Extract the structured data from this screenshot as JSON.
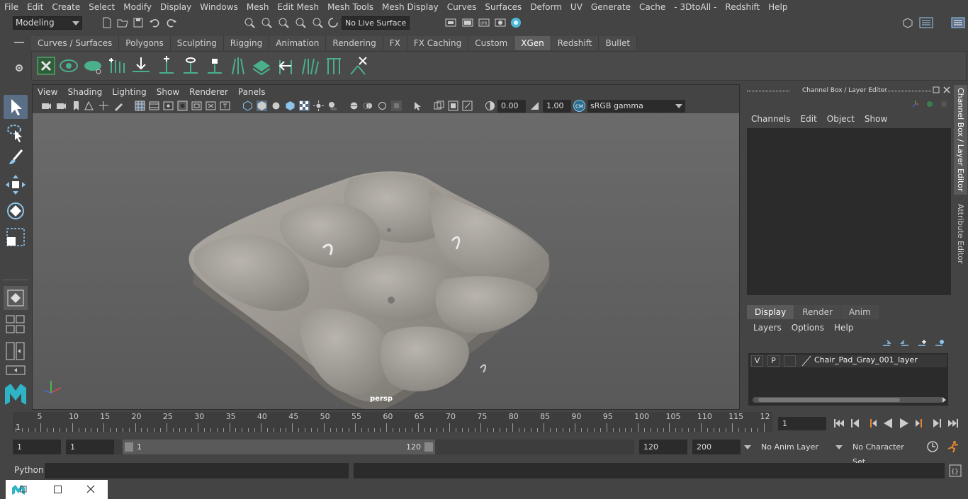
{
  "menubar": {
    "items": [
      "File",
      "Edit",
      "Create",
      "Select",
      "Modify",
      "Display",
      "Windows",
      "Mesh",
      "Edit Mesh",
      "Mesh Tools",
      "Mesh Display",
      "Curves",
      "Surfaces",
      "Deform",
      "UV",
      "Generate",
      "Cache",
      "- 3DtoAll -",
      "Redshift",
      "Help"
    ]
  },
  "statusline": {
    "mode": "Modeling",
    "live_surface": "No Live Surface"
  },
  "shelf": {
    "tabs": [
      "Curves / Surfaces",
      "Polygons",
      "Sculpting",
      "Rigging",
      "Animation",
      "Rendering",
      "FX",
      "FX Caching",
      "Custom",
      "XGen",
      "Redshift",
      "Bullet"
    ],
    "active_tab": "XGen"
  },
  "viewport": {
    "menu": [
      "View",
      "Shading",
      "Lighting",
      "Show",
      "Renderer",
      "Panels"
    ],
    "exposure": "0.00",
    "gamma_value": "1.00",
    "color_space": "sRGB gamma",
    "camera_label": "persp"
  },
  "channel_box": {
    "title": "Channel Box / Layer Editor",
    "menu": [
      "Channels",
      "Edit",
      "Object",
      "Show"
    ]
  },
  "layer_editor": {
    "tabs": [
      "Display",
      "Render",
      "Anim"
    ],
    "active_tab": "Display",
    "menu": [
      "Layers",
      "Options",
      "Help"
    ],
    "layer": {
      "visible": "V",
      "playback": "P",
      "name": "Chair_Pad_Gray_001_layer"
    }
  },
  "side_tabs": [
    "Channel Box / Layer Editor",
    "Attribute Editor"
  ],
  "timeline": {
    "ticks": [
      "5",
      "10",
      "15",
      "20",
      "25",
      "30",
      "35",
      "40",
      "45",
      "50",
      "55",
      "60",
      "65",
      "70",
      "75",
      "80",
      "85",
      "90",
      "95",
      "100",
      "105",
      "110",
      "115",
      "12"
    ],
    "start_label": "1",
    "current_frame": "1"
  },
  "range": {
    "start_frame": "1",
    "playback_start": "1",
    "range_start": "1",
    "range_end": "120",
    "playback_end": "120",
    "end_frame": "200",
    "anim_layer": "No Anim Layer",
    "character_set": "No Character Set"
  },
  "command_line": {
    "label": "Python"
  },
  "colors": {
    "accent": "#5a6f86",
    "shelf_icon_green": "#49b08b",
    "cushion": "#9a968f"
  }
}
